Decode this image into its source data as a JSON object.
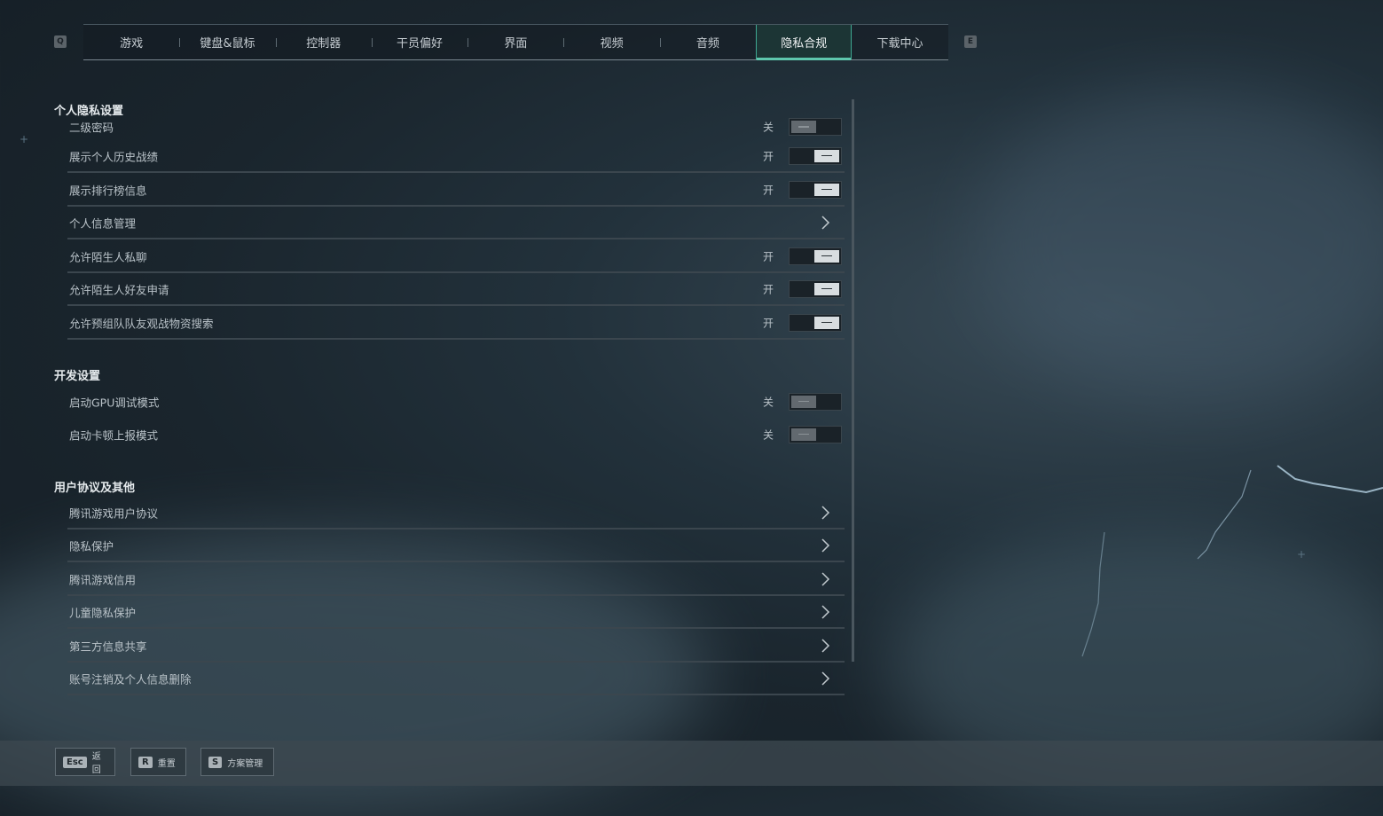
{
  "tabs": {
    "left_key": "Q",
    "right_key": "E",
    "items": [
      {
        "label": "游戏"
      },
      {
        "label": "键盘&鼠标"
      },
      {
        "label": "控制器"
      },
      {
        "label": "干员偏好"
      },
      {
        "label": "界面"
      },
      {
        "label": "视频"
      },
      {
        "label": "音频"
      },
      {
        "label": "隐私合规",
        "active": true
      },
      {
        "label": "下载中心"
      }
    ]
  },
  "privacy": {
    "title": "个人隐私设置",
    "rows": [
      {
        "label": "二级密码",
        "state": "关",
        "type": "toggle",
        "on": false
      },
      {
        "label": "展示个人历史战绩",
        "state": "开",
        "type": "toggle",
        "on": true
      },
      {
        "label": "展示排行榜信息",
        "state": "开",
        "type": "toggle",
        "on": true
      },
      {
        "label": "个人信息管理",
        "type": "link"
      },
      {
        "label": "允许陌生人私聊",
        "state": "开",
        "type": "toggle",
        "on": true
      },
      {
        "label": "允许陌生人好友申请",
        "state": "开",
        "type": "toggle",
        "on": true
      },
      {
        "label": "允许预组队队友观战物资搜索",
        "state": "开",
        "type": "toggle",
        "on": true
      }
    ]
  },
  "dev": {
    "title": "开发设置",
    "rows": [
      {
        "label": "启动GPU调试模式",
        "state": "关",
        "type": "toggle",
        "on": false
      },
      {
        "label": "启动卡顿上报模式",
        "state": "关",
        "type": "toggle",
        "on": false
      }
    ]
  },
  "agreements": {
    "title": "用户协议及其他",
    "rows": [
      {
        "label": "腾讯游戏用户协议"
      },
      {
        "label": "隐私保护"
      },
      {
        "label": "腾讯游戏信用"
      },
      {
        "label": "儿童隐私保护"
      },
      {
        "label": "第三方信息共享"
      },
      {
        "label": "账号注销及个人信息删除"
      }
    ]
  },
  "bottom": {
    "buttons": [
      {
        "key": "Esc",
        "label": "返回"
      },
      {
        "key": "R",
        "label": "重置"
      },
      {
        "key": "S",
        "label": "方案管理"
      }
    ]
  },
  "colors": {
    "accent": "#5ec7ad",
    "toggle_on": "#d8dde0",
    "toggle_off": "#62696f"
  }
}
